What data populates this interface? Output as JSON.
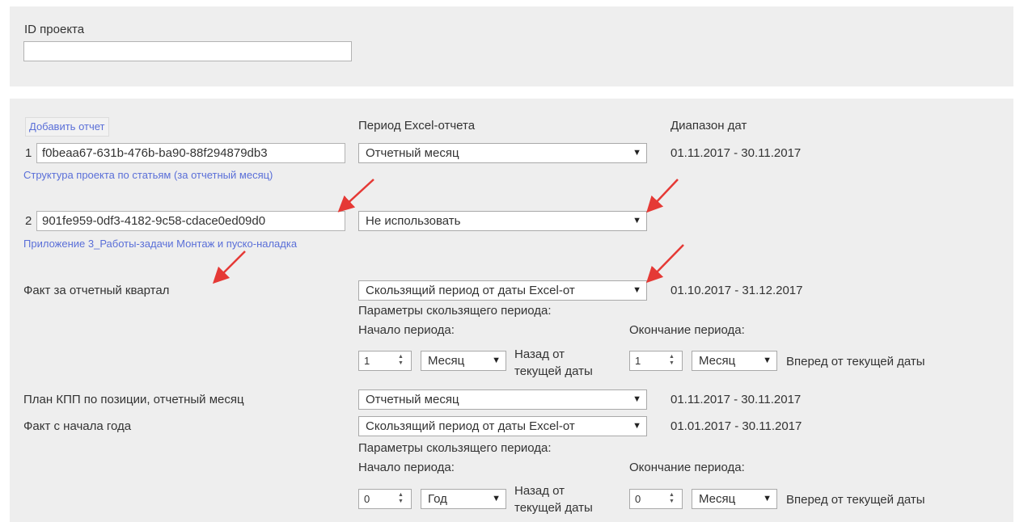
{
  "project": {
    "label": "ID проекта",
    "value": ""
  },
  "reports": {
    "add_button": "Добавить отчет",
    "period_header": "Период Excel-отчета",
    "range_header": "Диапазон дат",
    "rows": [
      {
        "num": "1",
        "id": "f0beaa67-631b-476b-ba90-88f294879db3",
        "link": "Структура проекта по статьям (за отчетный месяц)",
        "period": "Отчетный месяц",
        "range": "01.11.2017 - 30.11.2017"
      },
      {
        "num": "2",
        "id": "901fe959-0df3-4182-9c58-cdace0ed09d0",
        "link": "Приложение 3_Работы-задачи Монтаж и пуско-наладка",
        "period": "Не использовать",
        "range": ""
      }
    ],
    "fact_quarter": {
      "label": "Факт за отчетный квартал",
      "period": "Скользящий период от даты Excel-от",
      "range": "01.10.2017 - 31.12.2017",
      "params_title": "Параметры скользящего периода:",
      "start_label": "Начало периода:",
      "end_label": "Окончание периода:",
      "start_value": "1",
      "start_unit": "Месяц",
      "back_text_1": "Назад от",
      "back_text_2": "текущей даты",
      "end_value": "1",
      "end_unit": "Месяц",
      "forward_text": "Вперед от текущей даты"
    },
    "plan_kpp": {
      "label": "План КПП по позиции, отчетный месяц",
      "period": "Отчетный месяц",
      "range": "01.11.2017 - 30.11.2017"
    },
    "fact_year": {
      "label": "Факт с начала года",
      "period": "Скользящий период от даты Excel-от",
      "range": "01.01.2017 - 30.11.2017",
      "params_title": "Параметры скользящего периода:",
      "start_label": "Начало периода:",
      "end_label": "Окончание периода:",
      "start_value": "0",
      "start_unit": "Год",
      "back_text_1": "Назад от",
      "back_text_2": "текущей даты",
      "end_value": "0",
      "end_unit": "Месяц",
      "forward_text": "Вперед от текущей даты"
    }
  },
  "icons": {
    "caret": "▼",
    "stepper_up": "▲",
    "stepper_down": "▼"
  },
  "colors": {
    "link": "#5a6fd8",
    "panel": "#eeeeee",
    "annotation_arrow": "#e53935"
  }
}
